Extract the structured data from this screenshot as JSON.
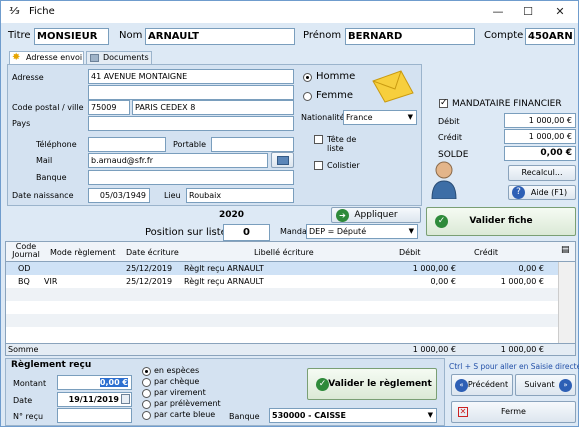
{
  "window": {
    "title": "Fiche",
    "controls": [
      "—",
      "☐",
      "✕"
    ]
  },
  "header": {
    "titre_label": "Titre",
    "titre_value": "MONSIEUR",
    "nom_label": "Nom",
    "nom_value": "ARNAULT",
    "prenom_label": "Prénom",
    "prenom_value": "BERNARD",
    "compte_label": "Compte",
    "compte_value": "450ARN"
  },
  "tabs": [
    {
      "label": "Adresse envoi"
    },
    {
      "label": "Documents"
    }
  ],
  "address": {
    "adresse_label": "Adresse",
    "adresse_value": "41 AVENUE MONTAIGNE",
    "adresse2_value": "",
    "cp_label": "Code postal / ville",
    "cp_value": "75009",
    "ville_value": "PARIS CEDEX 8",
    "pays_label": "Pays",
    "pays_value": "",
    "telephone_label": "Téléphone",
    "telephone_value": "",
    "portable_label": "Portable",
    "portable_value": "",
    "mail_label": "Mail",
    "mail_value": "b.arnaud@sfr.fr",
    "banque_label": "Banque",
    "banque_value": "",
    "naissance_label": "Date naissance",
    "naissance_value": "05/03/1949",
    "lieu_label": "Lieu",
    "lieu_value": "Roubaix",
    "homme_label": "Homme",
    "femme_label": "Femme",
    "nationalite_label": "Nationalité",
    "nationalite_value": "France",
    "tete_liste_label": "Tête de liste",
    "colistier_label": "Colistier"
  },
  "finance": {
    "mandataire_label": "MANDATAIRE FINANCIER",
    "debit_label": "Débit",
    "debit_value": "1 000,00 €",
    "credit_label": "Crédit",
    "credit_value": "1 000,00 €",
    "solde_label": "SOLDE",
    "solde_value": "0,00 €",
    "recalcul_label": "Recalcul...",
    "aide_label": "Aide (F1)"
  },
  "middle": {
    "year": "2020",
    "position_label": "Position sur liste",
    "position_value": "0",
    "appliquer_label": "Appliquer",
    "mandat_label": "Mandat",
    "mandat_value": "DEP = Député",
    "valider_fiche_label": "Valider fiche"
  },
  "grid": {
    "headers": [
      "Code Journal",
      "Mode règlement",
      "Date écriture",
      "Libellé écriture",
      "Débit",
      "Crédit"
    ],
    "rows": [
      {
        "code": "OD",
        "mode": "",
        "date": "25/12/2019",
        "libelle": "Règlt reçu ARNAULT",
        "debit": "1 000,00 €",
        "credit": "0,00 €"
      },
      {
        "code": "BQ",
        "mode": "VIR",
        "date": "25/12/2019",
        "libelle": "Règlt reçu ARNAULT",
        "debit": "0,00 €",
        "credit": "1 000,00 €"
      }
    ],
    "somme_label": "Somme",
    "somme_debit": "1 000,00 €",
    "somme_credit": "1 000,00 €"
  },
  "reglement": {
    "section_label": "Règlement reçu",
    "montant_label": "Montant",
    "montant_value": "0,00 €",
    "date_label": "Date",
    "date_value": "19/11/2019",
    "nrecu_label": "N° reçu",
    "nrecu_value": "",
    "options": [
      "en espèces",
      "par chèque",
      "par virement",
      "par prélèvement",
      "par carte bleue"
    ],
    "valider_label": "Valider le règlement",
    "banque_label": "Banque",
    "banque_value": "530000 - CAISSE",
    "hint": "Ctrl + S pour aller en Saisie directe",
    "precedent_label": "Précédent",
    "suivant_label": "Suivant",
    "ferme_label": "Ferme"
  }
}
